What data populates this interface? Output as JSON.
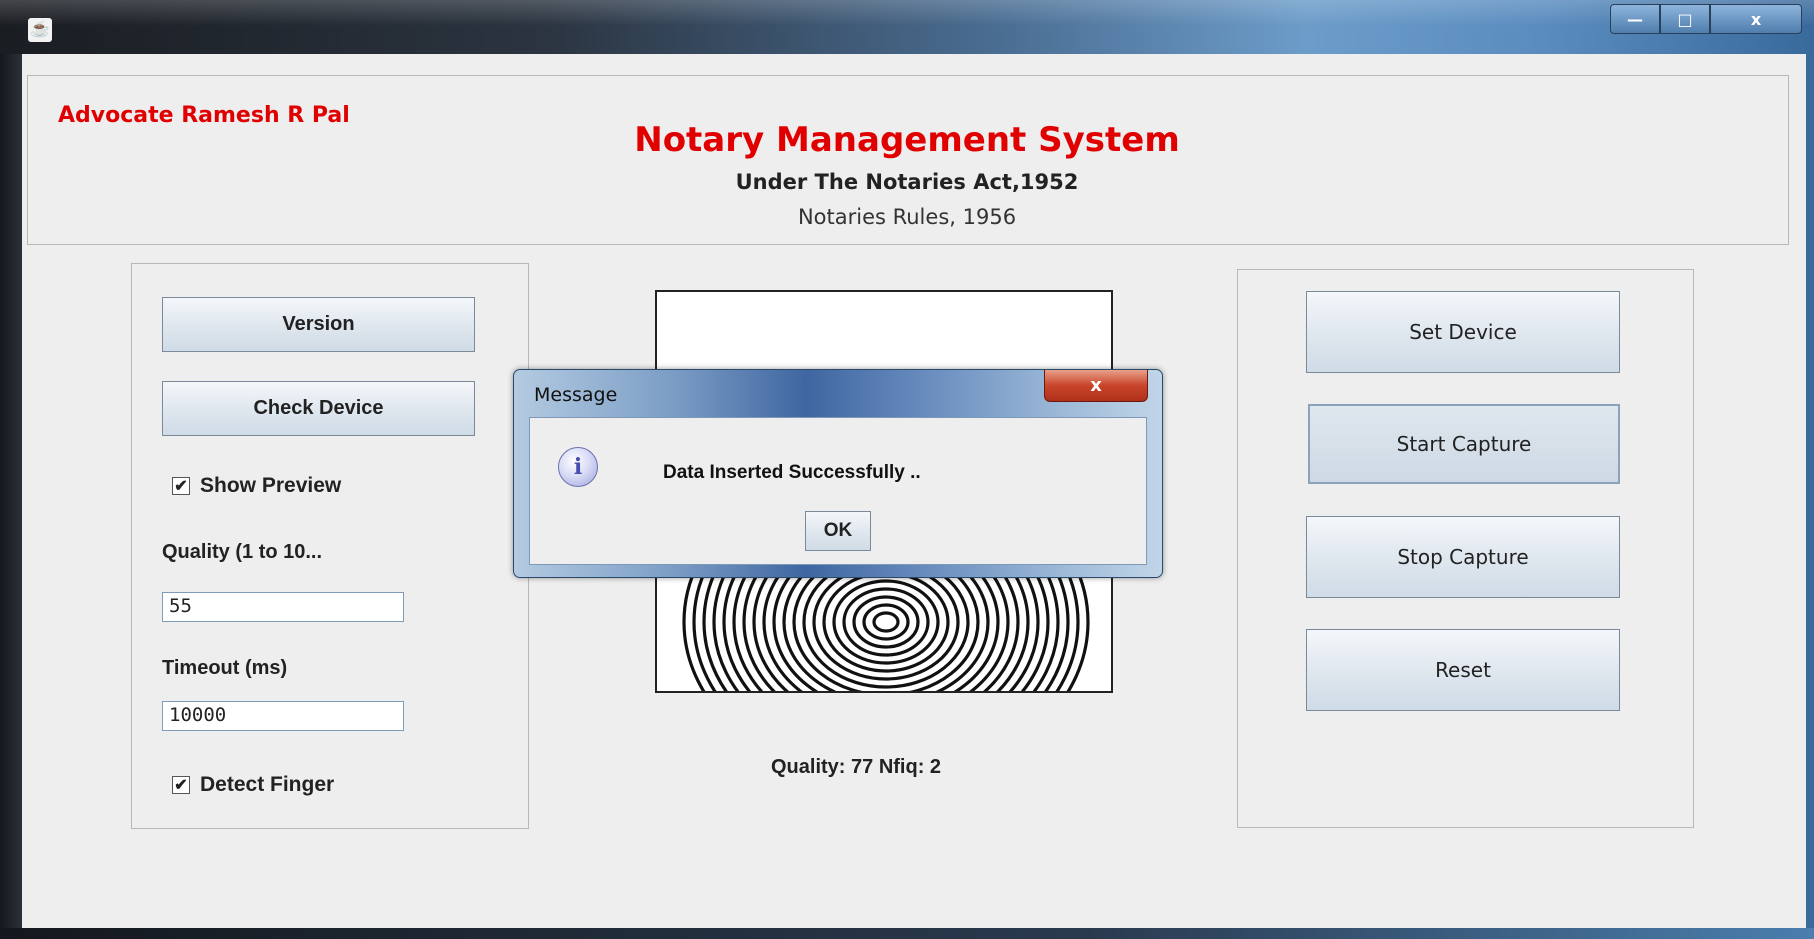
{
  "window": {
    "minimize_label": "—",
    "maximize_label": "□",
    "close_label": "x"
  },
  "header": {
    "advocate": "Advocate Ramesh R Pal",
    "title": "Notary Management System",
    "subtitle1": "Under The Notaries Act,1952",
    "subtitle2": "Notaries Rules, 1956"
  },
  "left_panel": {
    "version_label": "Version",
    "check_device_label": "Check Device",
    "show_preview": {
      "label": "Show Preview",
      "checked": true,
      "mark": "✔"
    },
    "quality_label": "Quality (1 to 10...",
    "quality_value": "55",
    "timeout_label": "Timeout (ms)",
    "timeout_value": "10000",
    "detect_finger": {
      "label": "Detect Finger",
      "checked": true,
      "mark": "✔"
    }
  },
  "center": {
    "quality_readout": "Quality: 77 Nfiq: 2"
  },
  "right_panel": {
    "set_device_label": "Set Device",
    "start_capture_label": "Start Capture",
    "stop_capture_label": "Stop Capture",
    "reset_label": "Reset"
  },
  "dialog": {
    "title": "Message",
    "close_label": "x",
    "icon_glyph": "i",
    "message": "Data Inserted Successfully ..",
    "ok_label": "OK"
  }
}
